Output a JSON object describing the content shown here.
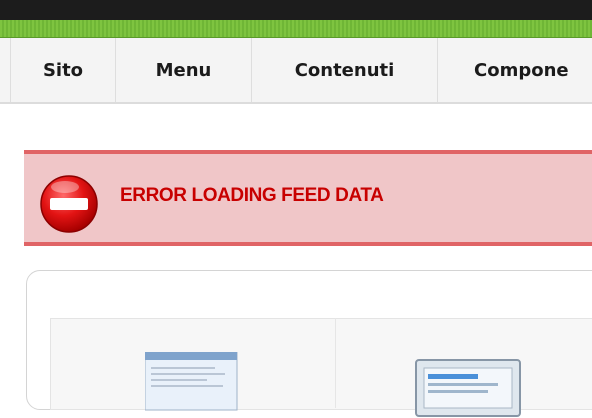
{
  "menu": {
    "items": [
      {
        "label": "Sito"
      },
      {
        "label": "Menu"
      },
      {
        "label": "Contenuti"
      },
      {
        "label": "Compone"
      }
    ]
  },
  "error": {
    "message": "ERROR LOADING FEED DATA",
    "icon": "no-entry-icon"
  },
  "panel": {
    "icons": [
      "article-manager-icon",
      "window-icon"
    ]
  },
  "colors": {
    "accent_green": "#7ec440",
    "error_red": "#c80000",
    "error_bg": "#f0c6c8"
  }
}
